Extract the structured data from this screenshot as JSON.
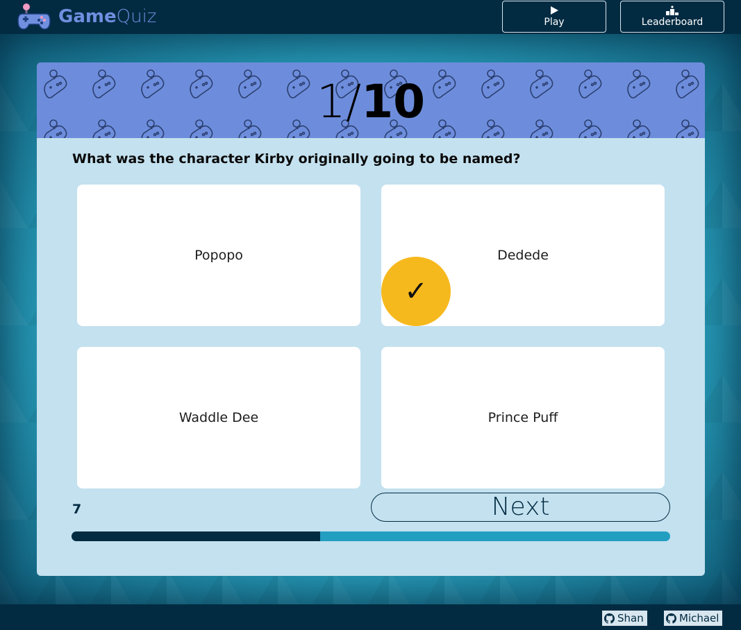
{
  "header": {
    "brand_game": "Game",
    "brand_quiz": "Quiz",
    "play_label": "Play",
    "leaderboard_label": "Leaderboard",
    "icons": {
      "logo": "gamepad-icon",
      "play": "play-icon",
      "leaderboard": "podium-icon"
    }
  },
  "quiz": {
    "current": "1",
    "separator": "/",
    "total": "10",
    "question": "What was the character Kirby originally going to be named?",
    "answers": [
      {
        "label": "Popopo"
      },
      {
        "label": "Dedede"
      },
      {
        "label": "Waddle Dee"
      },
      {
        "label": "Prince Puff"
      }
    ],
    "selected_mark": "✓",
    "timer": "7",
    "next_label": "Next",
    "progress_fraction": 0.415
  },
  "footer": {
    "links": [
      {
        "label": "Shan",
        "icon": "github-icon"
      },
      {
        "label": "Michael",
        "icon": "github-icon"
      }
    ]
  },
  "colors": {
    "navy": "#022b42",
    "brand": "#6f8fdf",
    "banner": "#6d8ddc",
    "card": "#c4e1ef",
    "accent": "#f6b91d",
    "progress_track": "#229ec1"
  }
}
